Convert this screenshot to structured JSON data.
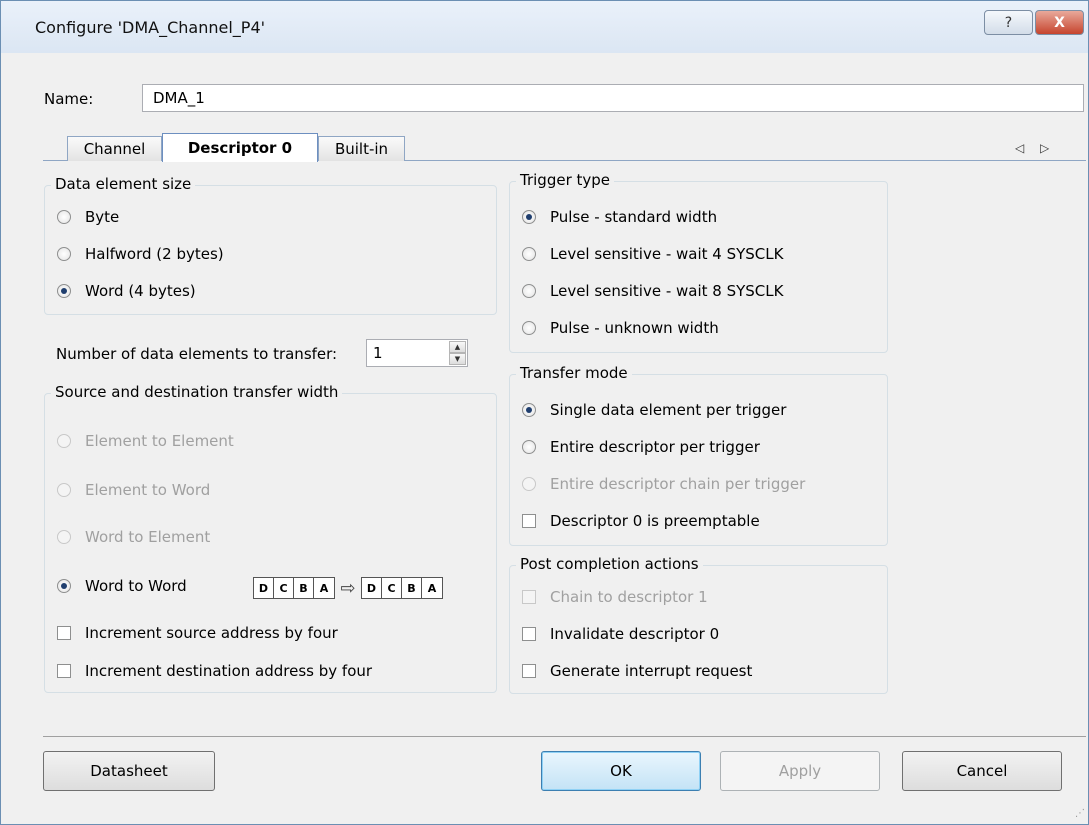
{
  "window": {
    "title": "Configure 'DMA_Channel_P4'",
    "help_label": "?",
    "close_label": "X"
  },
  "name": {
    "label": "Name:",
    "value": "DMA_1"
  },
  "tabs": [
    {
      "label": "Channel"
    },
    {
      "label": "Descriptor 0"
    },
    {
      "label": "Built-in"
    }
  ],
  "tab_arrows": "◁ ▷",
  "data_element_size": {
    "legend": "Data element size",
    "options": [
      {
        "label": "Byte",
        "selected": false
      },
      {
        "label": "Halfword (2 bytes)",
        "selected": false
      },
      {
        "label": "Word (4 bytes)",
        "selected": true
      }
    ]
  },
  "num_elements": {
    "label": "Number of data elements to transfer:",
    "value": "1"
  },
  "transfer_width": {
    "legend": "Source and destination transfer width",
    "options": [
      {
        "label": "Element to Element",
        "selected": false,
        "enabled": false
      },
      {
        "label": "Element to Word",
        "selected": false,
        "enabled": false
      },
      {
        "label": "Word to Element",
        "selected": false,
        "enabled": false
      },
      {
        "label": "Word to Word",
        "selected": true,
        "enabled": true
      }
    ],
    "byte_diagram": {
      "source": [
        "D",
        "C",
        "B",
        "A"
      ],
      "dest": [
        "D",
        "C",
        "B",
        "A"
      ],
      "arrow": "⇨"
    },
    "checks": [
      {
        "label": "Increment source address by four",
        "checked": false
      },
      {
        "label": "Increment destination address by four",
        "checked": false
      }
    ]
  },
  "trigger_type": {
    "legend": "Trigger type",
    "options": [
      {
        "label": "Pulse - standard width",
        "selected": true
      },
      {
        "label": "Level sensitive - wait 4 SYSCLK",
        "selected": false
      },
      {
        "label": "Level sensitive - wait 8 SYSCLK",
        "selected": false
      },
      {
        "label": "Pulse - unknown width",
        "selected": false
      }
    ]
  },
  "transfer_mode": {
    "legend": "Transfer mode",
    "options": [
      {
        "label": "Single data element per trigger",
        "selected": true,
        "enabled": true
      },
      {
        "label": "Entire descriptor per trigger",
        "selected": false,
        "enabled": true
      },
      {
        "label": "Entire descriptor chain per trigger",
        "selected": false,
        "enabled": false
      }
    ],
    "check": {
      "label": "Descriptor 0 is preemptable",
      "checked": false
    }
  },
  "post_completion": {
    "legend": "Post completion actions",
    "checks": [
      {
        "label": "Chain to descriptor 1",
        "checked": false,
        "enabled": false
      },
      {
        "label": "Invalidate descriptor 0",
        "checked": false,
        "enabled": true
      },
      {
        "label": "Generate interrupt request",
        "checked": false,
        "enabled": true
      }
    ]
  },
  "buttons": {
    "datasheet": "Datasheet",
    "ok": "OK",
    "apply": "Apply",
    "cancel": "Cancel"
  }
}
